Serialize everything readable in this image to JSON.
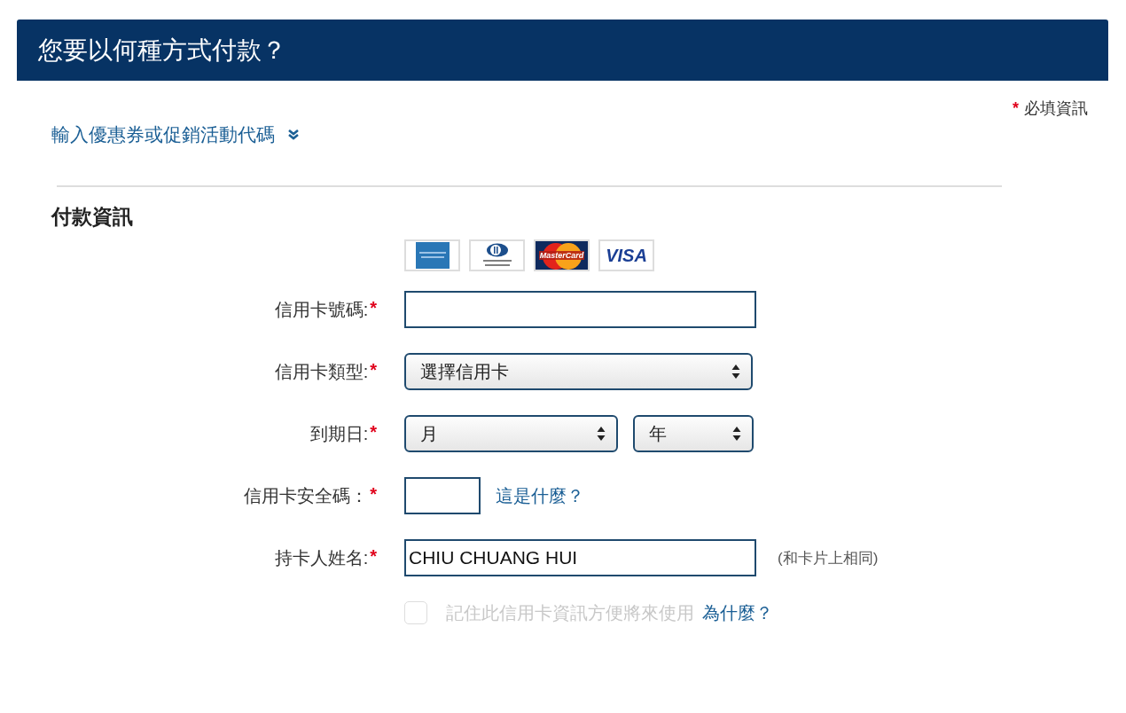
{
  "header": {
    "title": "您要以何種方式付款？"
  },
  "required_note": {
    "mark": "*",
    "text": "必填資訊"
  },
  "promo_link": {
    "label": "輸入優惠券或促銷活動代碼",
    "expanded": false
  },
  "section_title": "付款資訊",
  "card_logos": [
    {
      "kind": "amex"
    },
    {
      "kind": "diners"
    },
    {
      "kind": "mastercard",
      "text": "MasterCard"
    },
    {
      "kind": "visa",
      "text": "VISA"
    }
  ],
  "fields": [
    {
      "kind": "text",
      "label": "信用卡號碼:",
      "mark": "*"
    },
    {
      "kind": "select",
      "label": "信用卡類型:",
      "mark": "*",
      "selects": [
        {
          "value": "選擇信用卡"
        }
      ]
    },
    {
      "kind": "select",
      "label": "到期日:",
      "mark": "*",
      "selects": [
        {
          "value": "月"
        },
        {
          "value": "年"
        }
      ]
    },
    {
      "kind": "short",
      "label": "信用卡安全碼：",
      "mark": "*",
      "link": "這是什麼？"
    },
    {
      "kind": "text",
      "label": "持卡人姓名:",
      "mark": "*",
      "value": "CHIU CHUANG HUI",
      "note": "(和卡片上相同)"
    }
  ],
  "remember": {
    "checked": false,
    "disabled": true,
    "label": "記住此信用卡資訊方便將來使用",
    "link": "為什麼？"
  }
}
